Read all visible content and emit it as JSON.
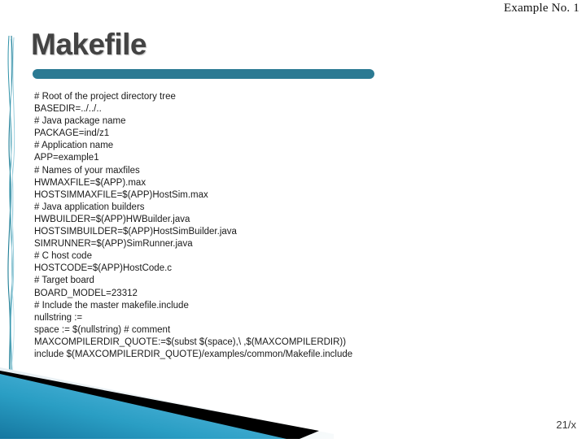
{
  "header": {
    "label": "Example No. 1"
  },
  "title": {
    "text": "Makefile"
  },
  "colors": {
    "title_text": "#434343",
    "accent_bar": "#2b7a93",
    "ribbon_dark": "#1d7d95",
    "ribbon_light": "#8fc9da",
    "wedge_dark": "#17809f",
    "wedge_light": "#58b8dc",
    "wedge_pale": "#dde9ef",
    "wedge_black": "#000000"
  },
  "code": {
    "lines": [
      "# Root of the project directory tree",
      "BASEDIR=../../..",
      "# Java package name",
      "PACKAGE=ind/z1",
      "# Application name",
      "APP=example1",
      "# Names of your maxfiles",
      "HWMAXFILE=$(APP).max",
      "HOSTSIMMAXFILE=$(APP)HostSim.max",
      "# Java application builders",
      "HWBUILDER=$(APP)HWBuilder.java",
      "HOSTSIMBUILDER=$(APP)HostSimBuilder.java",
      "SIMRUNNER=$(APP)SimRunner.java",
      "# C host code",
      "HOSTCODE=$(APP)HostCode.c",
      "# Target board",
      "BOARD_MODEL=23312",
      "# Include the master makefile.include",
      "nullstring :=",
      "space := $(nullstring) # comment",
      "MAXCOMPILERDIR_QUOTE:=$(subst $(space),\\ ,$(MAXCOMPILERDIR))",
      "include $(MAXCOMPILERDIR_QUOTE)/examples/common/Makefile.include"
    ]
  },
  "footer": {
    "slide_number": "21/x"
  }
}
